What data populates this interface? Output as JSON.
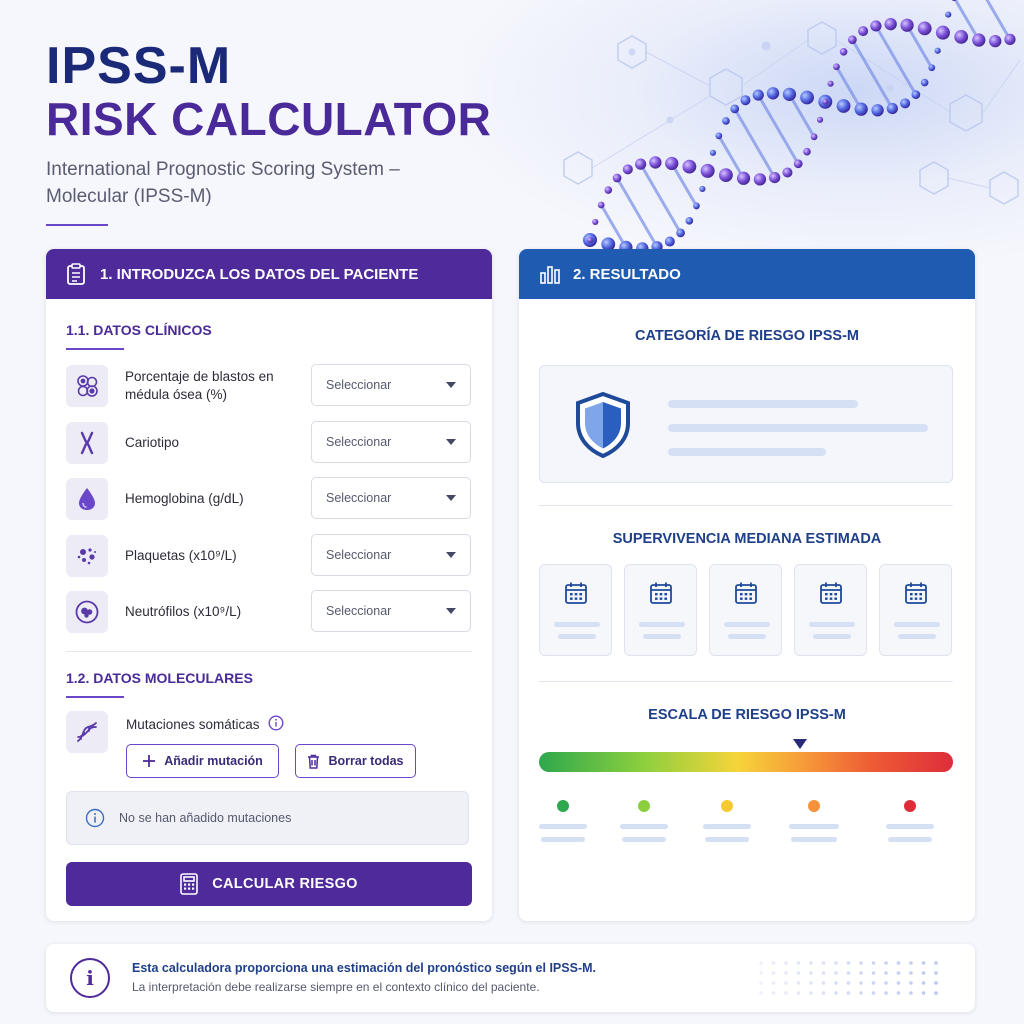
{
  "header": {
    "title_line1": "IPSS-M",
    "title_line2": "RISK CALCULATOR",
    "subtitle": "International Prognostic Scoring System – Molecular (IPSS-M)"
  },
  "input_panel": {
    "heading": "1. INTRODUZCA LOS DATOS DEL PACIENTE",
    "clinical_section": "1.1. DATOS CLÍNICOS",
    "clinical_fields": [
      {
        "label": "Porcentaje de blastos en médula ósea (%)",
        "value": "Seleccionar",
        "icon": "bone-marrow-cells-icon"
      },
      {
        "label": "Cariotipo",
        "value": "Seleccionar",
        "icon": "chromosome-icon"
      },
      {
        "label": "Hemoglobina (g/dL)",
        "value": "Seleccionar",
        "icon": "blood-drop-icon"
      },
      {
        "label": "Plaquetas (x10⁹/L)",
        "value": "Seleccionar",
        "icon": "platelets-icon"
      },
      {
        "label": "Neutrófilos (x10⁹/L)",
        "value": "Seleccionar",
        "icon": "neutrophil-icon"
      }
    ],
    "molecular_section": "1.2. DATOS MOLECULARES",
    "mutations_label": "Mutaciones somáticas",
    "add_mutation": "Añadir mutación",
    "clear_all": "Borrar todas",
    "empty_notice": "No se han añadido mutaciones",
    "calculate": "CALCULAR RIESGO"
  },
  "result_panel": {
    "heading": "2. RESULTADO",
    "category_title": "CATEGORÍA DE RIESGO IPSS-M",
    "survival_title": "SUPERVIVENCIA MEDIANA ESTIMADA",
    "scale_title": "ESCALA DE RIESGO IPSS-M",
    "scale_marker_fraction": 0.63,
    "scale_dot_colors": [
      "#2ea84c",
      "#8ccf3e",
      "#f6c832",
      "#f7923a",
      "#dd2d3a"
    ]
  },
  "footer": {
    "line1": "Esta calculadora proporciona una estimación del pronóstico según el IPSS-M.",
    "line2": "La interpretación debe realizarse siempre en el contexto clínico del paciente."
  },
  "colors": {
    "brand_purple": "#4e2a9a",
    "brand_blue": "#1f5bb0",
    "title_navy": "#1b2a78"
  }
}
